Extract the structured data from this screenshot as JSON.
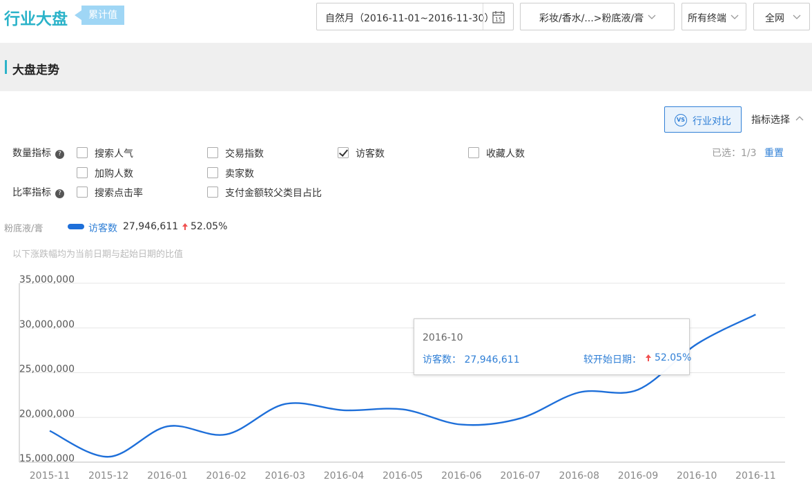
{
  "header": {
    "title": "行业大盘",
    "badge": "累计值",
    "date_range": "自然月（2016-11-01~2016-11-30）",
    "calendar_day": "15",
    "category": "彩妆/香水/...>粉底液/膏",
    "terminal": "所有终端",
    "network": "全网"
  },
  "section": {
    "title": "大盘走势"
  },
  "toolbar": {
    "compare_label": "行业对比",
    "compare_icon_text": "VS",
    "metric_select_label": "指标选择",
    "selected_count": "已选：1/3",
    "reset_label": "重置"
  },
  "metrics": {
    "quantity_label": "数量指标",
    "ratio_label": "比率指标",
    "help_glyph": "?",
    "items": [
      {
        "label": "搜索人气",
        "checked": false
      },
      {
        "label": "交易指数",
        "checked": false
      },
      {
        "label": "访客数",
        "checked": true
      },
      {
        "label": "收藏人数",
        "checked": false
      },
      {
        "label": "加购人数",
        "checked": false
      },
      {
        "label": "卖家数",
        "checked": false
      },
      {
        "label": "搜索点击率",
        "checked": false
      },
      {
        "label": "支付金额较父类目占比",
        "checked": false
      }
    ]
  },
  "legend": {
    "category": "粉底液/膏",
    "series_name": "访客数",
    "value": "27,946,611",
    "change": "52.05%",
    "note": "以下涨跌幅均为当前日期与起始日期的比值"
  },
  "tooltip": {
    "date": "2016-10",
    "name": "访客数：",
    "value": "27,946,611",
    "compare_label": "较开始日期：",
    "change": "52.05%"
  },
  "colors": {
    "accent": "#2bb3c9",
    "line": "#1e6fd9",
    "link": "#2f7fd6",
    "up": "#f0504f"
  },
  "chart_data": {
    "type": "line",
    "categories": [
      "2015-11",
      "2015-12",
      "2016-01",
      "2016-02",
      "2016-03",
      "2016-04",
      "2016-05",
      "2016-06",
      "2016-07",
      "2016-08",
      "2016-09",
      "2016-10",
      "2016-11"
    ],
    "series": [
      {
        "name": "访客数",
        "values": [
          18500000,
          15600000,
          19000000,
          18100000,
          21500000,
          20800000,
          20900000,
          19200000,
          19900000,
          22800000,
          23100000,
          28200000,
          31500000
        ]
      }
    ],
    "ylim": [
      15000000,
      35000000
    ],
    "yticks": [
      15000000,
      20000000,
      25000000,
      30000000,
      35000000
    ],
    "ytick_labels": [
      "15,000,000",
      "20,000,000",
      "25,000,000",
      "30,000,000",
      "35,000,000"
    ],
    "grid": true
  }
}
